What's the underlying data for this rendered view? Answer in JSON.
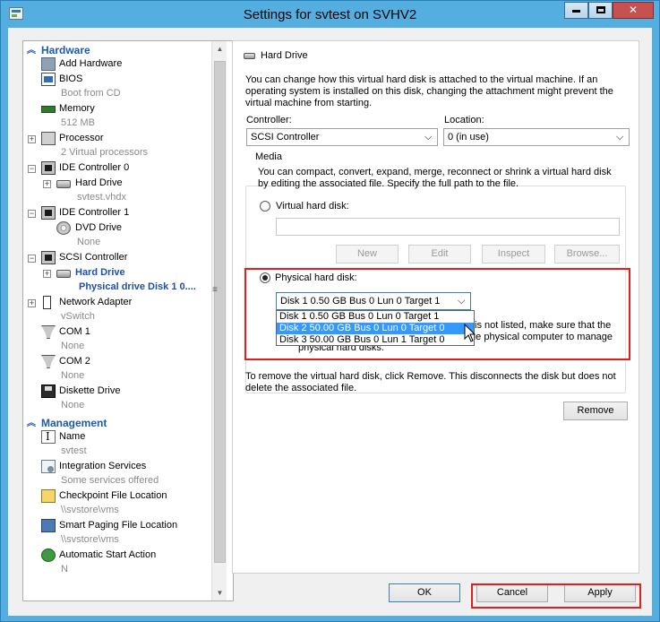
{
  "window": {
    "title": "Settings for svtest on SVHV2",
    "icon": "settings-app-icon"
  },
  "tree": {
    "hardware_header": "Hardware",
    "management_header": "Management",
    "hardware_items": [
      {
        "label": "Add Hardware",
        "sub": "",
        "icon": "add-hardware-icon"
      },
      {
        "label": "BIOS",
        "sub": "Boot from CD",
        "icon": "bios-icon"
      },
      {
        "label": "Memory",
        "sub": "512 MB",
        "icon": "memory-icon"
      },
      {
        "label": "Processor",
        "sub": "2 Virtual processors",
        "icon": "processor-icon"
      },
      {
        "label": "IDE Controller 0",
        "sub": "",
        "icon": "ide-controller-icon"
      },
      {
        "label": "Hard Drive",
        "sub": "svtest.vhdx",
        "icon": "hard-drive-icon"
      },
      {
        "label": "IDE Controller 1",
        "sub": "",
        "icon": "ide-controller-icon"
      },
      {
        "label": "DVD Drive",
        "sub": "None",
        "icon": "dvd-drive-icon"
      },
      {
        "label": "SCSI Controller",
        "sub": "",
        "icon": "scsi-controller-icon"
      },
      {
        "label": "Hard Drive",
        "sub": "Physical drive Disk 1 0....",
        "icon": "hard-drive-icon"
      },
      {
        "label": "Network Adapter",
        "sub": "vSwitch",
        "icon": "network-adapter-icon"
      },
      {
        "label": "COM 1",
        "sub": "None",
        "icon": "com-port-icon"
      },
      {
        "label": "COM 2",
        "sub": "None",
        "icon": "com-port-icon"
      },
      {
        "label": "Diskette Drive",
        "sub": "None",
        "icon": "diskette-drive-icon"
      }
    ],
    "management_items": [
      {
        "label": "Name",
        "sub": "svtest",
        "icon": "name-icon"
      },
      {
        "label": "Integration Services",
        "sub": "Some services offered",
        "icon": "integration-services-icon"
      },
      {
        "label": "Checkpoint File Location",
        "sub": "\\\\svstore\\vms",
        "icon": "checkpoint-folder-icon"
      },
      {
        "label": "Smart Paging File Location",
        "sub": "\\\\svstore\\vms",
        "icon": "smart-paging-icon"
      },
      {
        "label": "Automatic Start Action",
        "sub": "N",
        "icon": "automatic-start-icon"
      }
    ]
  },
  "panel": {
    "title": "Hard Drive",
    "intro": "You can change how this virtual hard disk is attached to the virtual machine. If an operating system is installed on this disk, changing the attachment might prevent the virtual machine from starting.",
    "controller_label": "Controller:",
    "controller_value": "SCSI Controller",
    "location_label": "Location:",
    "location_value": "0 (in use)",
    "media_title": "Media",
    "media_text": "You can compact, convert, expand, merge, reconnect or shrink a virtual hard disk by editing the associated file. Specify the full path to the file.",
    "virtual_hd_label": "Virtual hard disk:",
    "virtual_hd_value": "",
    "buttons": {
      "new": "New",
      "edit": "Edit",
      "inspect": "Inspect",
      "browse": "Browse..."
    },
    "physical_hd_label": "Physical hard disk:",
    "physical_selected": "Disk 1 0.50 GB Bus 0 Lun 0 Target 1",
    "physical_options": [
      "Disk 1 0.50 GB Bus 0 Lun 0 Target 1",
      "Disk 2 50.00 GB Bus 0 Lun 0 Target 0",
      "Disk 3 50.00 GB Bus 0 Lun 1 Target 0"
    ],
    "physical_note_1": "is not listed, make sure that the",
    "physical_note_2": "the physical computer to manage",
    "physical_note_3": "physical hard disks.",
    "remove_text": "To remove the virtual hard disk, click Remove. This disconnects the disk but does not delete the associated file.",
    "remove_button": "Remove"
  },
  "footer": {
    "ok": "OK",
    "cancel": "Cancel",
    "apply": "Apply"
  }
}
